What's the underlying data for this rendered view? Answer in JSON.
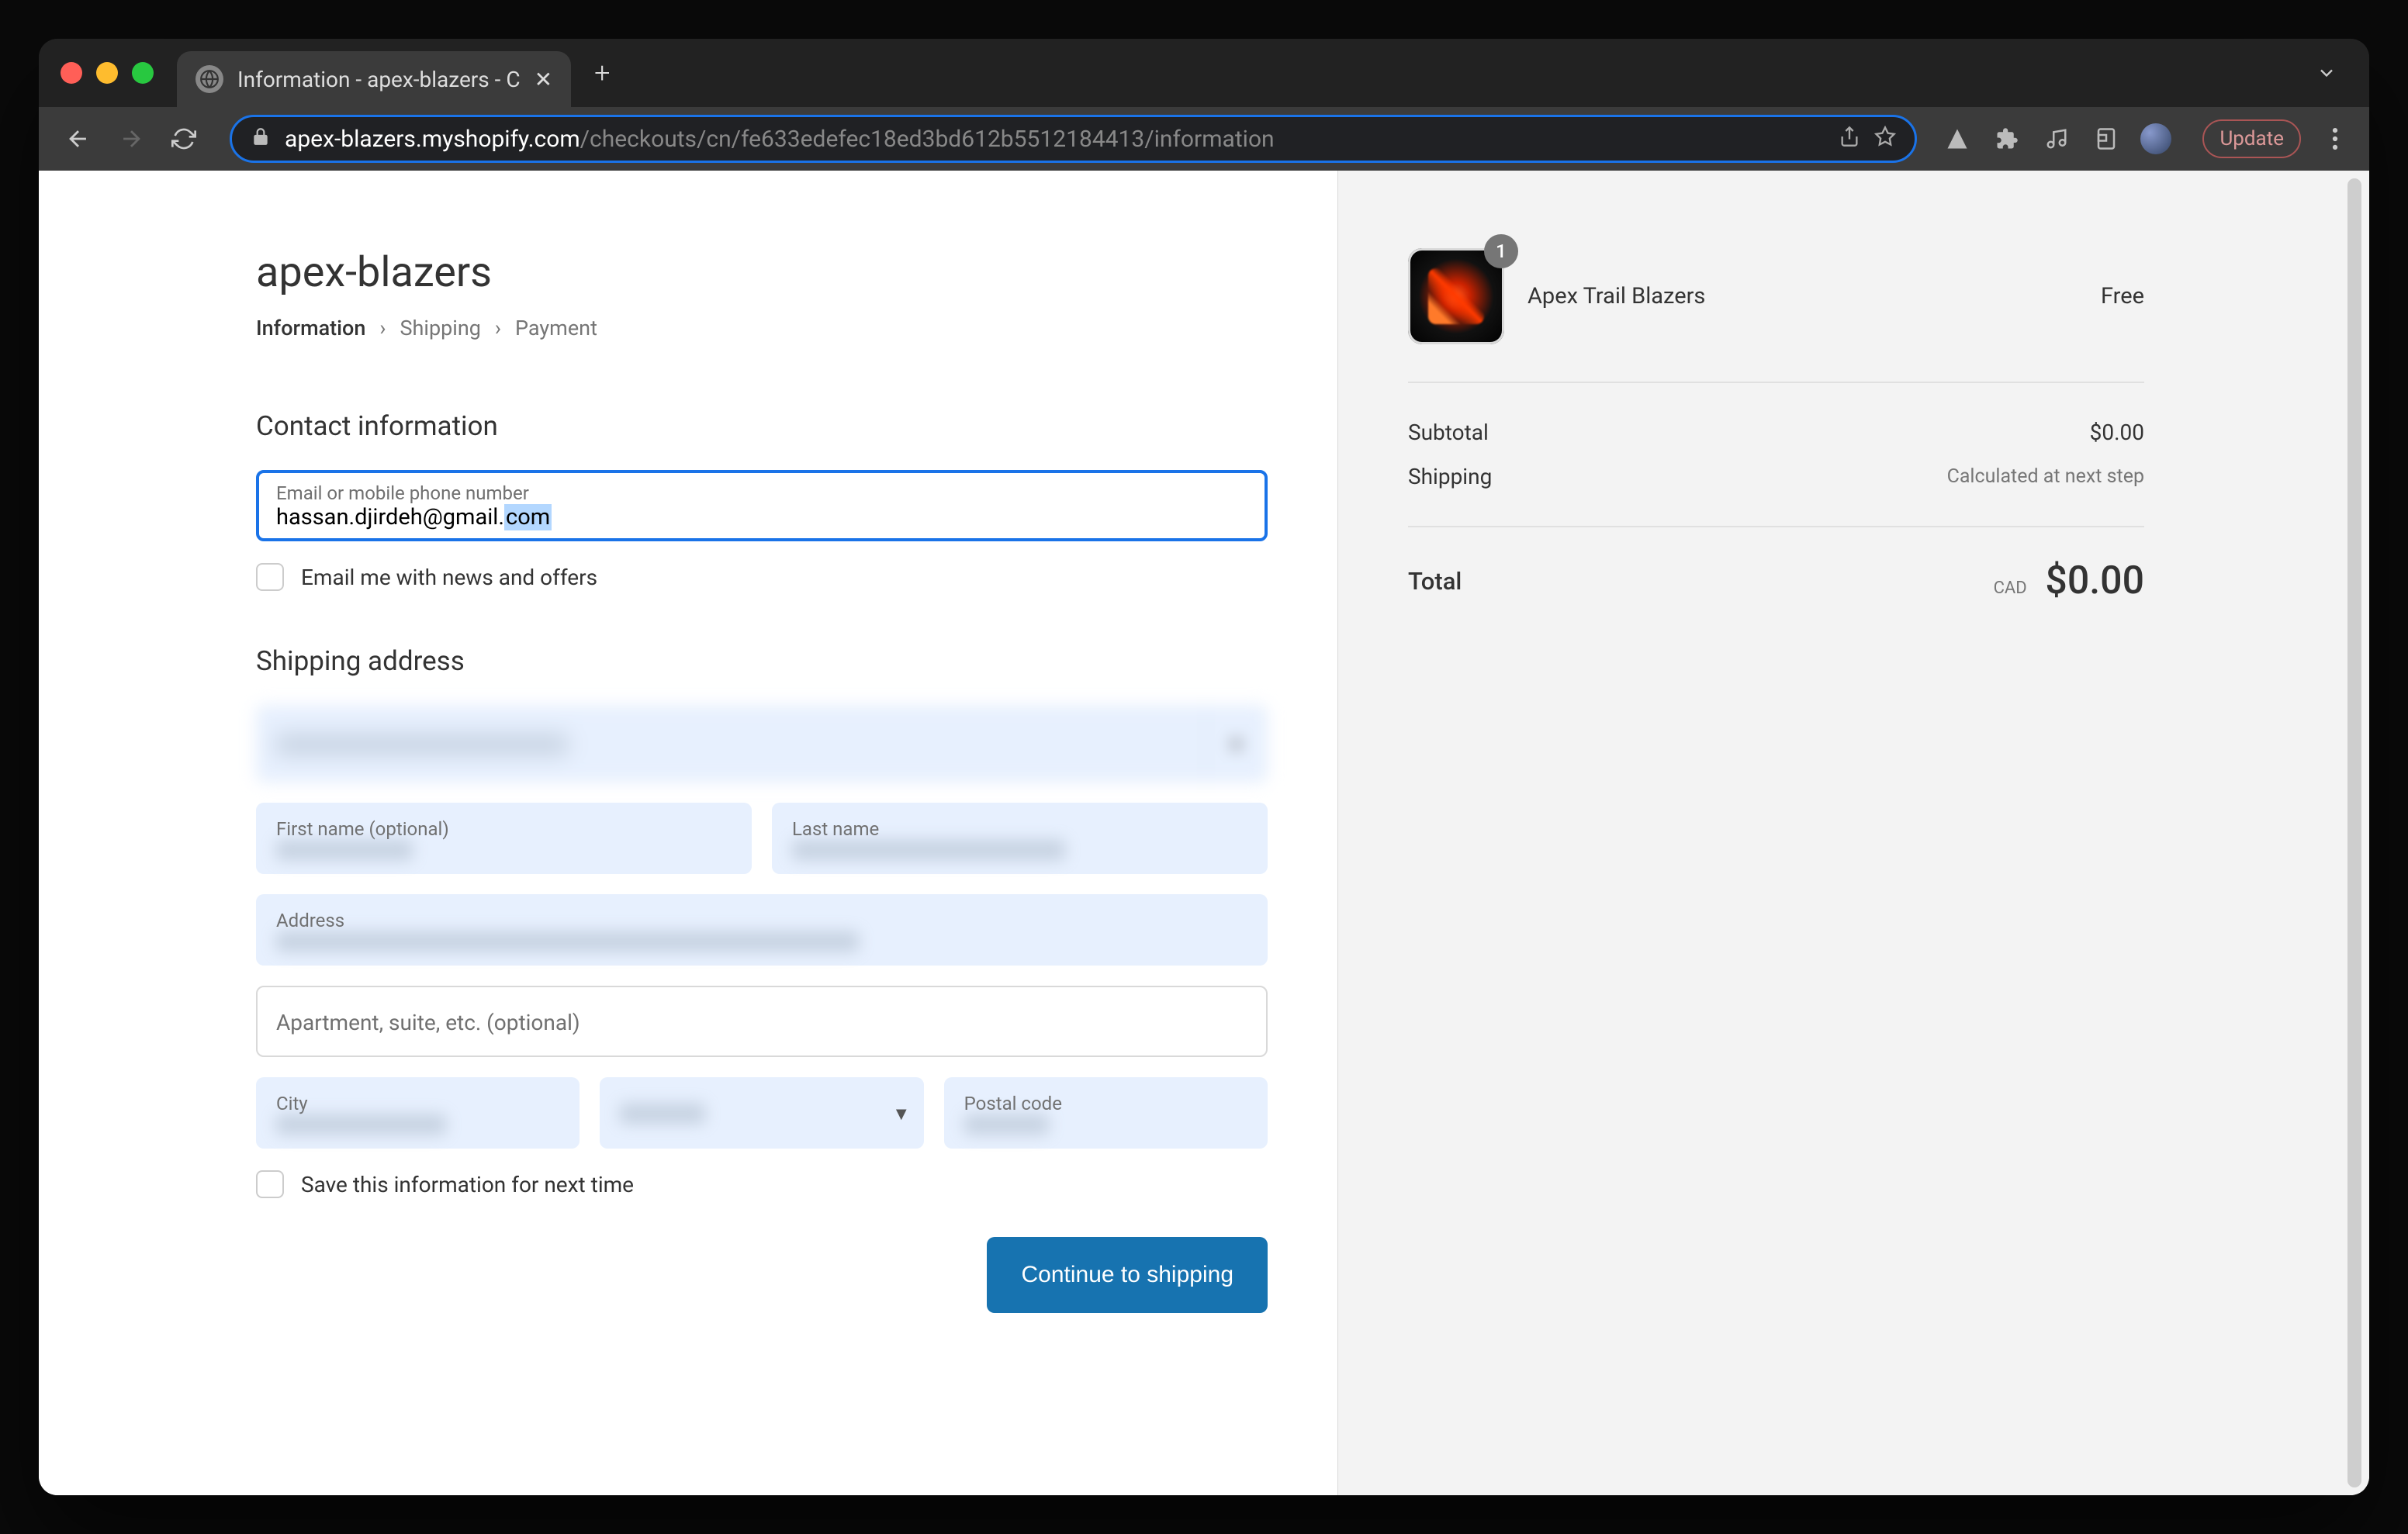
{
  "browser": {
    "tab_title": "Information - apex-blazers - C",
    "url_host": "apex-blazers.myshopify.com",
    "url_path": "/checkouts/cn/fe633edefec18ed3bd612b5512184413/information",
    "update_label": "Update"
  },
  "header": {
    "store_name": "apex-blazers",
    "breadcrumb": [
      "Information",
      "Shipping",
      "Payment"
    ],
    "breadcrumb_active_index": 0
  },
  "contact": {
    "heading": "Contact information",
    "email_label": "Email or mobile phone number",
    "email_value_prefix": "hassan.djirdeh@gmail.",
    "email_value_selected": "com",
    "newsletter_label": "Email me with news and offers",
    "newsletter_checked": false
  },
  "shipping": {
    "heading": "Shipping address",
    "country_label": "",
    "first_name_label": "First name (optional)",
    "last_name_label": "Last name",
    "address_label": "Address",
    "apartment_placeholder": "Apartment, suite, etc. (optional)",
    "city_label": "City",
    "province_label": "",
    "postal_code_label": "Postal code",
    "save_info_label": "Save this information for next time",
    "save_info_checked": false,
    "continue_button": "Continue to shipping"
  },
  "cart": {
    "items": [
      {
        "name": "Apex Trail Blazers",
        "qty": 1,
        "price": "Free"
      }
    ],
    "subtotal_label": "Subtotal",
    "subtotal_value": "$0.00",
    "shipping_label": "Shipping",
    "shipping_value": "Calculated at next step",
    "total_label": "Total",
    "total_currency": "CAD",
    "total_value": "$0.00"
  }
}
